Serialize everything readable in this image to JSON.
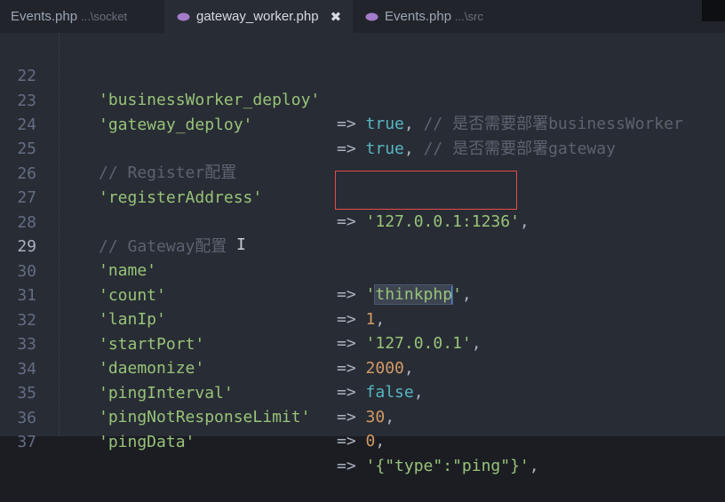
{
  "tabs": [
    {
      "name": "Events.php",
      "path": "...\\socket",
      "active": false
    },
    {
      "name": "gateway_worker.php",
      "path": "",
      "active": true,
      "close": "✖"
    },
    {
      "name": "Events.php",
      "path": "...\\src",
      "active": false
    }
  ],
  "colors": {
    "string": "#98c379",
    "keyword": "#56b6c2",
    "number": "#d19a66",
    "comment": "#5c6370",
    "highlight_box": "#e54b4b"
  },
  "lines": [
    {
      "n": "22",
      "key": "'businessWorker_deploy'",
      "op": "=>",
      "val": "true",
      "tail": ",",
      "comment": "// 是否需要部署businessWorker"
    },
    {
      "n": "23",
      "key": "'gateway_deploy'",
      "op": "=>",
      "val": "true",
      "tail": ",",
      "comment": "// 是否需要部署gateway"
    },
    {
      "n": "24"
    },
    {
      "n": "25",
      "comment": "// Register配置"
    },
    {
      "n": "26",
      "key": "'registerAddress'",
      "op": "=>",
      "val": "'127.0.0.1:1236'",
      "tail": ","
    },
    {
      "n": "27"
    },
    {
      "n": "28",
      "comment": "// Gateway配置"
    },
    {
      "n": "29",
      "key": "'name'",
      "op": "=>",
      "val_pre": "'",
      "val_sel": "thinkphp",
      "val_post": "'",
      "tail": ","
    },
    {
      "n": "30",
      "key": "'count'",
      "op": "=>",
      "val": "1",
      "tail": ","
    },
    {
      "n": "31",
      "key": "'lanIp'",
      "op": "=>",
      "val": "'127.0.0.1'",
      "tail": ","
    },
    {
      "n": "32",
      "key": "'startPort'",
      "op": "=>",
      "val": "2000",
      "tail": ","
    },
    {
      "n": "33",
      "key": "'daemonize'",
      "op": "=>",
      "val": "false",
      "tail": ","
    },
    {
      "n": "34",
      "key": "'pingInterval'",
      "op": "=>",
      "val": "30",
      "tail": ","
    },
    {
      "n": "35",
      "key": "'pingNotResponseLimit'",
      "op": "=>",
      "val": "0",
      "tail": ","
    },
    {
      "n": "36",
      "key": "'pingData'",
      "op": "=>",
      "val": "'{\"type\":\"ping\"}'",
      "tail": ","
    },
    {
      "n": "37"
    }
  ],
  "mouse_cursor": "I"
}
